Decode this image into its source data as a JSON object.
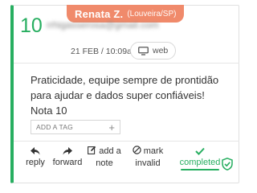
{
  "author": {
    "name": "Renata Z.",
    "location": "(Louveira/SP)"
  },
  "score": "10",
  "email_blurred": "rrhigasserosa@gmail.com",
  "date": "21 FEB / 10:09am",
  "source": {
    "label": "web",
    "icon": "monitor-icon"
  },
  "comment_lines": [
    "Praticidade, equipe sempre de prontidão",
    "para ajudar e dados super confiáveis!",
    "Nota 10"
  ],
  "tag_input": {
    "placeholder": "ADD A TAG",
    "icon": "plus-icon"
  },
  "actions": {
    "reply": {
      "label": "reply",
      "icon": "reply-icon"
    },
    "forward": {
      "label": "forward",
      "icon": "forward-icon"
    },
    "add_note": {
      "line1": "add a",
      "line2": "note",
      "icon": "edit-icon"
    },
    "invalid": {
      "line1": "mark",
      "line2": "invalid",
      "icon": "block-icon"
    },
    "completed": {
      "label": "completed",
      "icon": "check-icon"
    }
  },
  "colors": {
    "accent": "#27ae60",
    "badge": "#f08a6b"
  }
}
